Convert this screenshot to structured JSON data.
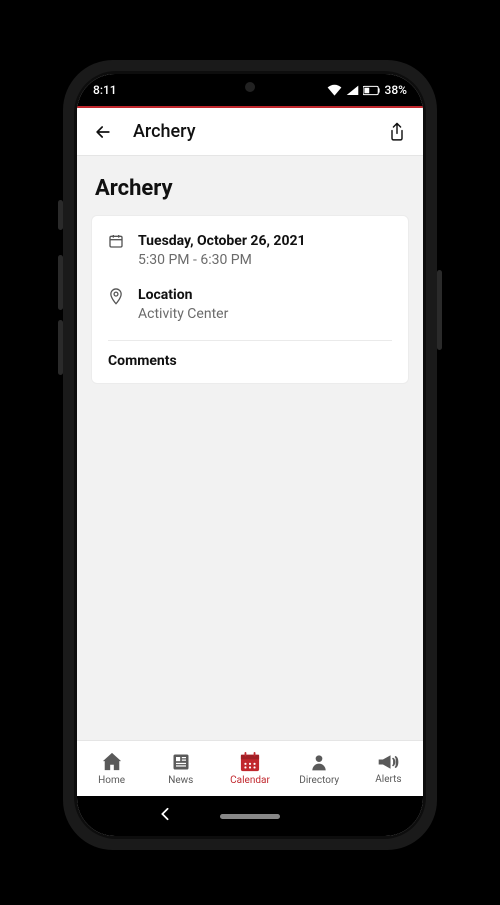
{
  "status": {
    "time": "8:11",
    "battery_pct": "38%"
  },
  "header": {
    "title": "Archery"
  },
  "event": {
    "title": "Archery",
    "date_label": "Tuesday, October 26, 2021",
    "time_label": "5:30 PM - 6:30 PM",
    "location_heading": "Location",
    "location_value": "Activity Center",
    "comments_heading": "Comments"
  },
  "nav": {
    "home": "Home",
    "news": "News",
    "calendar": "Calendar",
    "directory": "Directory",
    "alerts": "Alerts"
  },
  "colors": {
    "accent": "#c1272d"
  }
}
